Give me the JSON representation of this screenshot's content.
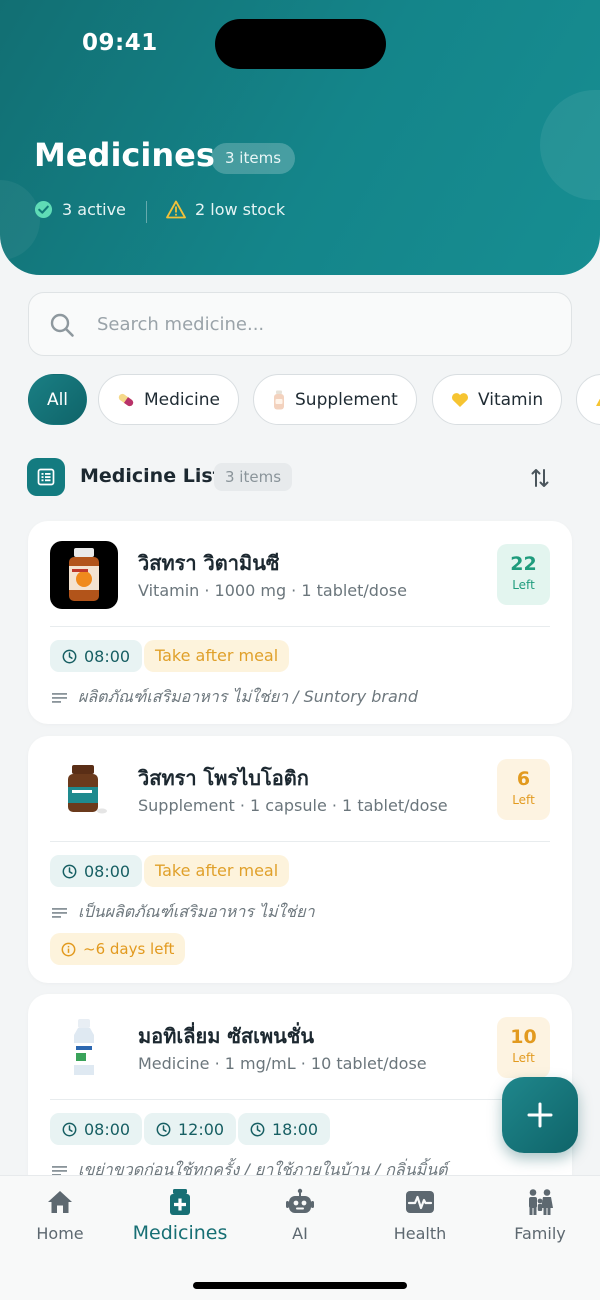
{
  "status_bar": {
    "time": "09:41"
  },
  "header": {
    "title": "Medicines",
    "count_badge": "3 items",
    "stats": [
      {
        "icon": "check-circle-icon",
        "text": "3 active",
        "color": "#5fdcb6"
      },
      {
        "icon": "warning-triangle-icon",
        "text": "2 low stock",
        "color": "#f2c13a"
      }
    ]
  },
  "search": {
    "placeholder": "Search medicine..."
  },
  "filters": [
    {
      "label": "All",
      "icon": "",
      "active": true
    },
    {
      "label": "Medicine",
      "icon": "pill-icon",
      "active": false
    },
    {
      "label": "Supplement",
      "icon": "bottle-icon",
      "active": false
    },
    {
      "label": "Vitamin",
      "icon": "heart-icon",
      "active": false
    }
  ],
  "list_header": {
    "title": "Medicine List",
    "count_badge": "3 items"
  },
  "medicines": [
    {
      "name": "วิสทรา วิตามินซี",
      "meta": "Vitamin · 1000 mg · 1 tablet/dose",
      "left_count": "22",
      "left_label": "Left",
      "left_status": "ok",
      "times": [
        "08:00"
      ],
      "instruction": "Take after meal",
      "note": "ผลิตภัณฑ์เสริมอาหาร ไม่ใช่ยา / Suntory brand",
      "warning": ""
    },
    {
      "name": "วิสทรา โพรไบโอติก",
      "meta": "Supplement · 1 capsule · 1 tablet/dose",
      "left_count": "6",
      "left_label": "Left",
      "left_status": "low",
      "times": [
        "08:00"
      ],
      "instruction": "Take after meal",
      "note": "เป็นผลิตภัณฑ์เสริมอาหาร ไม่ใช่ยา",
      "warning": "~6 days left"
    },
    {
      "name": "มอทิเลี่ยม ซัสเพนชั่น",
      "meta": "Medicine · 1 mg/mL · 10 tablet/dose",
      "left_count": "10",
      "left_label": "Left",
      "left_status": "low",
      "times": [
        "08:00",
        "12:00",
        "18:00"
      ],
      "instruction": "",
      "note": "เขย่าขวดก่อนใช้ทุกครั้ง / ยาใช้ภายในบ้าน / กลิ่นมิ้นต์",
      "warning": ""
    }
  ],
  "nav": [
    {
      "label": "Home",
      "icon": "home-icon",
      "active": false
    },
    {
      "label": "Medicines",
      "icon": "medicine-box-icon",
      "active": true
    },
    {
      "label": "AI",
      "icon": "robot-icon",
      "active": false
    },
    {
      "label": "Health",
      "icon": "heart-monitor-icon",
      "active": false
    },
    {
      "label": "Family",
      "icon": "family-icon",
      "active": false
    }
  ],
  "colors": {
    "brand": "#137b80",
    "ok_text": "#1f9c7d",
    "low_text": "#e29a1f"
  }
}
